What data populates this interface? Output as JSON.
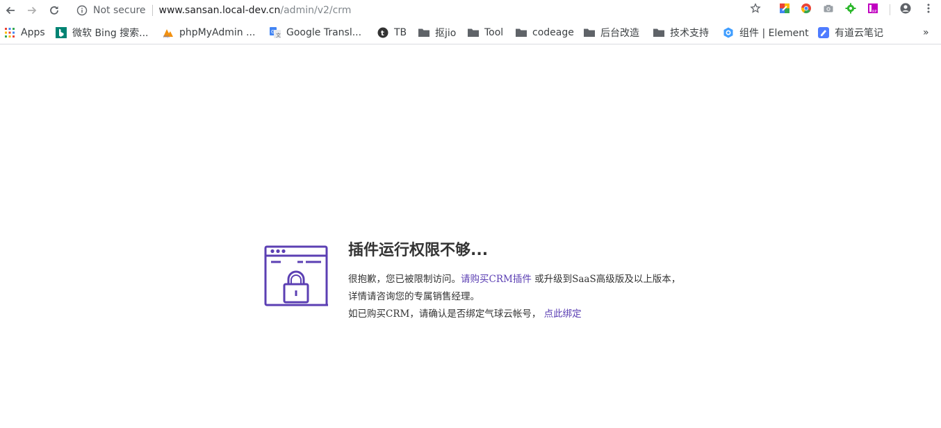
{
  "browser": {
    "security_label": "Not secure",
    "url_host": "www.sansan.local-dev.cn",
    "url_path": "/admin/v2/crm"
  },
  "bookmarks": {
    "items": [
      {
        "label": "Apps",
        "icon": "apps-grid-icon"
      },
      {
        "label": "微软 Bing 搜索...",
        "icon": "bing-icon"
      },
      {
        "label": "phpMyAdmin ...",
        "icon": "phpmyadmin-icon"
      },
      {
        "label": "Google Transl...",
        "icon": "google-translate-icon"
      },
      {
        "label": "TB",
        "icon": "taobao-icon"
      },
      {
        "label": "抠jio",
        "icon": "folder-icon"
      },
      {
        "label": "Tool",
        "icon": "folder-icon"
      },
      {
        "label": "codeage",
        "icon": "folder-icon"
      },
      {
        "label": "后台改造",
        "icon": "folder-icon"
      },
      {
        "label": "技术支持",
        "icon": "folder-icon"
      },
      {
        "label": "组件 | Element",
        "icon": "element-icon"
      },
      {
        "label": "有道云笔记",
        "icon": "youdao-note-icon"
      }
    ],
    "more_label": "»"
  },
  "page": {
    "title": "插件运行权限不够...",
    "line1_prefix": "很抱歉，您已被限制访问。",
    "line1_link": "请购买CRM插件",
    "line1_suffix": " 或升级到SaaS高级版及以上版本，",
    "line2": "详情请咨询您的专属销售经理。",
    "line3_prefix": "如已购买CRM，请确认是否绑定气球云帐号，",
    "line3_link": "点此绑定"
  },
  "colors": {
    "accent": "#5b3fb3",
    "illustration": "#5b3fb3",
    "text": "#333333"
  }
}
